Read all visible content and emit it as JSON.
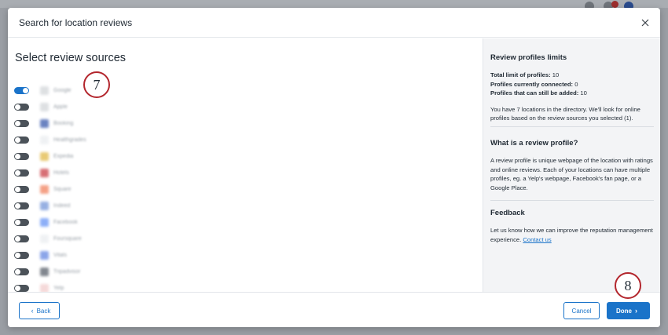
{
  "modal": {
    "title": "Search for location reviews",
    "close_icon": "close-icon"
  },
  "left": {
    "title": "Select review sources",
    "sources": [
      {
        "name": "Google",
        "enabled": true,
        "color": "#cfd3d7"
      },
      {
        "name": "Apple",
        "enabled": false,
        "color": "#cfd3d7"
      },
      {
        "name": "Booking",
        "enabled": false,
        "color": "#2c4fa8"
      },
      {
        "name": "Healthgrades",
        "enabled": false,
        "color": "#e9ecef"
      },
      {
        "name": "Expedia",
        "enabled": false,
        "color": "#e0b43a"
      },
      {
        "name": "Hotels",
        "enabled": false,
        "color": "#c7333b"
      },
      {
        "name": "Square",
        "enabled": false,
        "color": "#f07a54"
      },
      {
        "name": "Indeed",
        "enabled": false,
        "color": "#6c8fd6"
      },
      {
        "name": "Facebook",
        "enabled": false,
        "color": "#5d8ef5"
      },
      {
        "name": "Foursquare",
        "enabled": false,
        "color": "#e9ecef"
      },
      {
        "name": "Vitals",
        "enabled": false,
        "color": "#5b7fe0"
      },
      {
        "name": "Tripadvisor",
        "enabled": false,
        "color": "#4d5560"
      },
      {
        "name": "Yelp",
        "enabled": false,
        "color": "#f1c9c9"
      }
    ]
  },
  "annotations": {
    "step7": "7",
    "step8": "8"
  },
  "right": {
    "limits": {
      "heading": "Review profiles limits",
      "total_label": "Total limit of profiles:",
      "total_value": "10",
      "connected_label": "Profiles currently connected:",
      "connected_value": "0",
      "remaining_label": "Profiles that can still be added:",
      "remaining_value": "10",
      "description": "You have 7 locations in the directory. We'll look for online profiles based on the review sources you selected (1)."
    },
    "what": {
      "heading": "What is a review profile?",
      "description": "A review profile is unique webpage of the location with ratings and online reviews. Each of your locations can have multiple profiles, eg. a Yelp's webpage, Facebook's fan page, or a Google Place."
    },
    "feedback": {
      "heading": "Feedback",
      "description": "Let us know how we can improve the reputation management experience.",
      "link": "Contact us"
    }
  },
  "footer": {
    "back_label": "Back",
    "cancel_label": "Cancel",
    "done_label": "Done"
  },
  "colors": {
    "accent": "#1a73c9",
    "annotation": "#b3262d"
  }
}
